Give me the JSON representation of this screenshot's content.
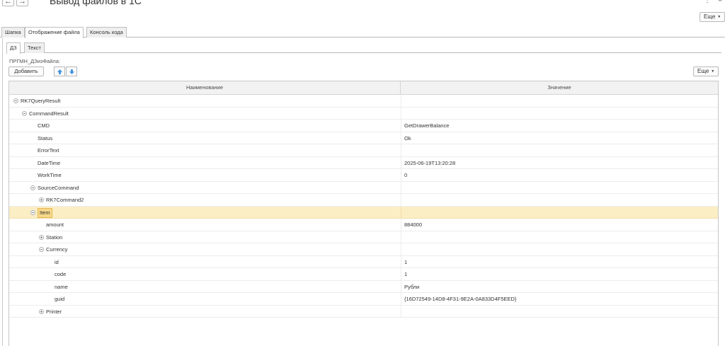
{
  "window": {
    "title": "Вывод файлов в 1С",
    "back_icon": "←",
    "forward_icon": "→",
    "menu_icon": "⋮",
    "close_icon": "×"
  },
  "more_label": "Еще",
  "main_tabs": [
    "Шапка",
    "Отображение файла",
    "Консоль кода"
  ],
  "inner_tabs": [
    "ДЗ",
    "Текст"
  ],
  "form": {
    "label": "ПРГМН_ДЗизФайла:",
    "add_button": "Добавить"
  },
  "grid": {
    "columns": [
      "Наименование",
      "Значение"
    ],
    "rows": [
      {
        "name": "RK7QueryResult",
        "value": "",
        "toggle": "minus"
      },
      {
        "name": "CommandResult",
        "value": "",
        "toggle": "minus"
      },
      {
        "name": "CMD",
        "value": "GetDrawerBalance",
        "toggle": ""
      },
      {
        "name": "Status",
        "value": "Ok",
        "toggle": ""
      },
      {
        "name": "ErrorText",
        "value": "",
        "toggle": ""
      },
      {
        "name": "DateTime",
        "value": "2025-06-19T13:20:28",
        "toggle": ""
      },
      {
        "name": "WorkTime",
        "value": "0",
        "toggle": ""
      },
      {
        "name": "SourceCommand",
        "value": "",
        "toggle": "minus"
      },
      {
        "name": "RK7Command2",
        "value": "",
        "toggle": "plus"
      },
      {
        "name": "Item",
        "value": "",
        "toggle": "minus",
        "selected": true
      },
      {
        "name": "amount",
        "value": "884000",
        "toggle": ""
      },
      {
        "name": "Station",
        "value": "",
        "toggle": "plus"
      },
      {
        "name": "Currency",
        "value": "",
        "toggle": "minus"
      },
      {
        "name": "id",
        "value": "1",
        "toggle": ""
      },
      {
        "name": "code",
        "value": "1",
        "toggle": ""
      },
      {
        "name": "name",
        "value": "Рубли",
        "toggle": ""
      },
      {
        "name": "guid",
        "value": "{16D72549-14D8-4F31-9E2A-0A833D4F5EED}",
        "toggle": ""
      },
      {
        "name": "Printer",
        "value": "",
        "toggle": "plus"
      }
    ]
  },
  "colors": {
    "selected_row": "#fbeec4",
    "arrow_blue": "#3f8fd9"
  }
}
